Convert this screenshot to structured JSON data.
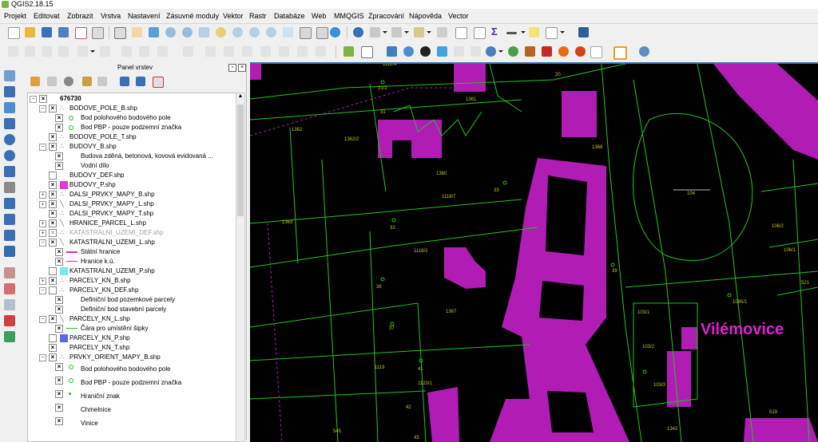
{
  "window": {
    "title": "QGIS2.18.15"
  },
  "menu": [
    "Projekt",
    "Editovat",
    "Zobrazit",
    "Vrstva",
    "Nastavení",
    "Zásuvné moduly",
    "Vektor",
    "Rastr",
    "Databáze",
    "Web",
    "MMQGIS",
    "Zpracování",
    "Nápověda",
    "Vector"
  ],
  "panel": {
    "title": "Panel vrstev"
  },
  "layers": [
    {
      "label": "676730",
      "indent": 0,
      "type": "group",
      "checked": true,
      "bold": true,
      "expanded": true
    },
    {
      "label": "BODOVE_POLE_B.shp",
      "indent": 1,
      "type": "layer",
      "checked": true,
      "expanded": true,
      "symbol": "point-cat"
    },
    {
      "label": "Bod polohového bodového pole",
      "indent": 2,
      "type": "class",
      "checked": true,
      "symbol": "circle-green"
    },
    {
      "label": "Bod PBP - pouze podzemní značka",
      "indent": 2,
      "type": "class",
      "checked": true,
      "symbol": "circle-green"
    },
    {
      "label": "BODOVE_POLE_T.shp",
      "indent": 1,
      "type": "layer",
      "checked": true,
      "symbol": "point-cat"
    },
    {
      "label": "BUDOVY_B.shp",
      "indent": 1,
      "type": "layer",
      "checked": true,
      "expanded": true,
      "symbol": "point-cat"
    },
    {
      "label": "Budova zděná, betonová, kovová evidovaná ...",
      "indent": 2,
      "type": "class",
      "checked": true,
      "symbol": "none"
    },
    {
      "label": "Vodní dílo",
      "indent": 2,
      "type": "class",
      "checked": true,
      "symbol": "none"
    },
    {
      "label": "BUDOVY_DEF.shp",
      "indent": 1,
      "type": "layer",
      "checked": false,
      "symbol": "none"
    },
    {
      "label": "BUDOVY_P.shp",
      "indent": 1,
      "type": "layer",
      "checked": true,
      "symbol": "fill-magenta"
    },
    {
      "label": "DALSI_PRVKY_MAPY_B.shp",
      "indent": 1,
      "type": "layer",
      "checked": true,
      "collapsed": true,
      "symbol": "point-cat"
    },
    {
      "label": "DALSI_PRVKY_MAPY_L.shp",
      "indent": 1,
      "type": "layer",
      "checked": true,
      "collapsed": true,
      "symbol": "line-cat"
    },
    {
      "label": "DALSI_PRVKY_MAPY_T.shp",
      "indent": 1,
      "type": "layer",
      "checked": true,
      "symbol": "point-cat"
    },
    {
      "label": "HRANICE_PARCEL_L.shp",
      "indent": 1,
      "type": "layer",
      "checked": true,
      "collapsed": true,
      "symbol": "line-cat"
    },
    {
      "label": "KATASTRALNI_UZEMI_DEF.shp",
      "indent": 1,
      "type": "layer",
      "checked": true,
      "greyed": true,
      "collapsed": true,
      "symbol": "point-cat"
    },
    {
      "label": "KATASTRALNI_UZEMI_L.shp",
      "indent": 1,
      "type": "layer",
      "checked": true,
      "expanded": true,
      "symbol": "line-cat"
    },
    {
      "label": "Státní hranice",
      "indent": 2,
      "type": "class",
      "checked": true,
      "symbol": "line-magenta-thick"
    },
    {
      "label": "Hranice k.ú.",
      "indent": 2,
      "type": "class",
      "checked": true,
      "symbol": "line-magenta"
    },
    {
      "label": "KATASTRALNI_UZEMI_P.shp",
      "indent": 1,
      "type": "layer",
      "checked": false,
      "symbol": "fill-cyan"
    },
    {
      "label": "PARCELY_KN_B.shp",
      "indent": 1,
      "type": "layer",
      "checked": true,
      "collapsed": true,
      "symbol": "point-cat"
    },
    {
      "label": "PARCELY_KN_DEF.shp",
      "indent": 1,
      "type": "layer",
      "checked": false,
      "expanded": true,
      "symbol": "point-cat"
    },
    {
      "label": "Definiční bod pozemkové parcely",
      "indent": 2,
      "type": "class",
      "checked": true,
      "symbol": "none"
    },
    {
      "label": "Definiční bod stavební parcely",
      "indent": 2,
      "type": "class",
      "checked": true,
      "symbol": "none"
    },
    {
      "label": "PARCELY_KN_L.shp",
      "indent": 1,
      "type": "layer",
      "checked": true,
      "expanded": true,
      "symbol": "line-cat"
    },
    {
      "label": "Čára pro umístění šipky",
      "indent": 2,
      "type": "class",
      "checked": true,
      "symbol": "line-green"
    },
    {
      "label": "PARCELY_KN_P.shp",
      "indent": 1,
      "type": "layer",
      "checked": false,
      "symbol": "fill-blue"
    },
    {
      "label": "PARCELY_KN_T.shp",
      "indent": 1,
      "type": "layer",
      "checked": true,
      "symbol": "none"
    },
    {
      "label": "PRVKY_ORIENT_MAPY_B.shp",
      "indent": 1,
      "type": "layer",
      "checked": true,
      "expanded": true,
      "symbol": "point-cat"
    },
    {
      "label": "Bod polohového bodového pole",
      "indent": 2,
      "type": "class",
      "checked": true,
      "symbol": "circle-green",
      "tall": true
    },
    {
      "label": "Bod PBP - pouze podzemní značka",
      "indent": 2,
      "type": "class",
      "checked": true,
      "symbol": "circle-green",
      "tall": true
    },
    {
      "label": "Hraniční znak",
      "indent": 2,
      "type": "class",
      "checked": true,
      "symbol": "dot-green",
      "tall": true
    },
    {
      "label": "Chmelnice",
      "indent": 2,
      "type": "class",
      "checked": true,
      "symbol": "none",
      "tall": true
    },
    {
      "label": "Vinice",
      "indent": 2,
      "type": "class",
      "checked": true,
      "symbol": "none",
      "tall": true
    }
  ],
  "map": {
    "place_name": "Vilémovice",
    "labels": [
      "1118/4",
      "20",
      "21/2",
      "1361",
      "31",
      "1362",
      "1362/2",
      "1368",
      "1360",
      "1118/7",
      "33",
      "104",
      "32",
      "1118/2",
      "1363",
      "106/2",
      "106/1",
      "36",
      "39",
      "1367",
      "1095/1",
      "103/1",
      "37",
      "103/2",
      "1119",
      "41",
      "103/3",
      "1120/1",
      "42",
      "43",
      "1342",
      "545",
      "519",
      "521"
    ],
    "colors": {
      "background": "#000000",
      "building": "#b01cb4",
      "parcel_line": "#1fc51f",
      "label": "#c8c800",
      "place": "#e020d0"
    }
  },
  "icons": {
    "toolbar1": [
      "new-project-icon",
      "open-project-icon",
      "save-project-icon",
      "save-as-icon",
      "new-print-composer-icon",
      "composer-manager-icon",
      "touch-zoom-icon",
      "pan-icon",
      "pan-to-selection-icon",
      "zoom-in-icon",
      "zoom-out-icon",
      "zoom-full-icon",
      "zoom-to-selection-icon",
      "zoom-to-layer-icon",
      "zoom-last-icon",
      "zoom-next-icon",
      "new-map-view-icon",
      "bookmark-icon",
      "refresh-icon",
      "identify-icon",
      "select-icon",
      "deselect-icon",
      "open-table-icon",
      "field-calc-icon",
      "measure-icon",
      "sigma-icon",
      "annotation-icon",
      "text-annotation-icon",
      "help-icon"
    ],
    "toolbar2": [
      "edit-pencil-icon",
      "save-edits-icon",
      "add-feature-icon",
      "move-feature-icon",
      "node-tool-icon",
      "delete-icon",
      "cut-icon",
      "copy-icon",
      "paste-icon",
      "undo-icon",
      "redo-icon",
      "python-icon",
      "plugin-icon",
      "db-manager-icon",
      "grass-icon",
      "georeferencer-icon",
      "processing-icon",
      "wfs-icon",
      "osm-icon",
      "composer-icon",
      "custom-icon"
    ]
  }
}
